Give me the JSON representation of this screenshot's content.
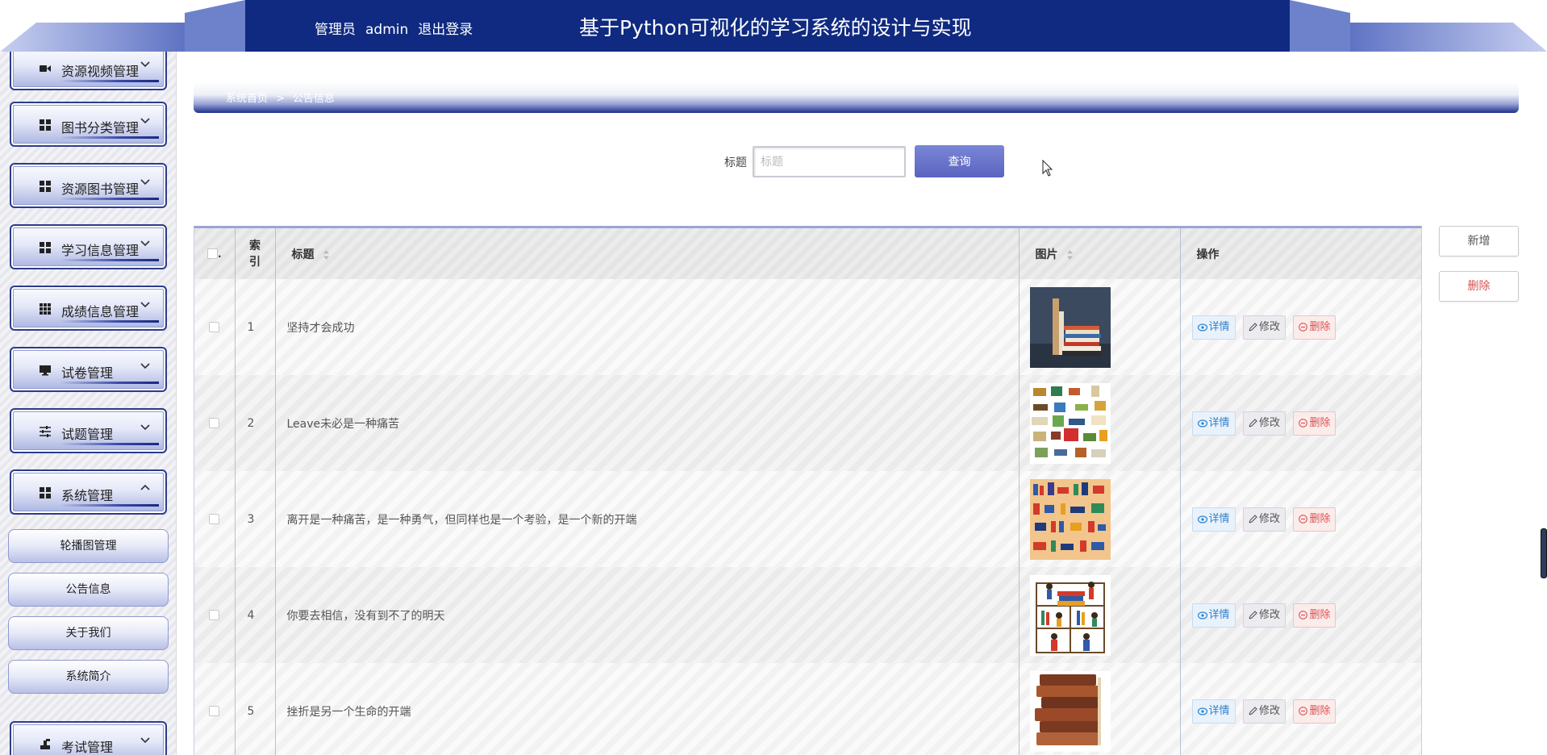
{
  "header": {
    "role": "管理员",
    "username": "admin",
    "logout_label": "退出登录",
    "title": "基于Python可视化的学习系统的设计与实现"
  },
  "sidebar": {
    "menus": [
      {
        "label": "资源视频管理",
        "icon": "video-camera-icon",
        "expanded": false
      },
      {
        "label": "图书分类管理",
        "icon": "grid-icon",
        "expanded": false
      },
      {
        "label": "资源图书管理",
        "icon": "grid-icon",
        "expanded": false
      },
      {
        "label": "学习信息管理",
        "icon": "grid-icon",
        "expanded": false
      },
      {
        "label": "成绩信息管理",
        "icon": "grid-nine-icon",
        "expanded": false
      },
      {
        "label": "试卷管理",
        "icon": "monitor-icon",
        "expanded": false
      },
      {
        "label": "试题管理",
        "icon": "sliders-icon",
        "expanded": false
      },
      {
        "label": "系统管理",
        "icon": "grid-icon",
        "expanded": true
      },
      {
        "label": "考试管理",
        "icon": "stamp-icon",
        "expanded": false
      }
    ],
    "submenu": [
      "轮播图管理",
      "公告信息",
      "关于我们",
      "系统简介"
    ]
  },
  "breadcrumb": {
    "home": "系统首页",
    "separator": ">",
    "current": "公告信息"
  },
  "search": {
    "label": "标题",
    "placeholder": "标题",
    "button": "查询"
  },
  "actions": {
    "add": "新增",
    "delete": "删除"
  },
  "table": {
    "columns": {
      "index": "索引",
      "title": "标题",
      "image": "图片",
      "operations": "操作"
    },
    "row_actions": {
      "detail": "详情",
      "edit": "修改",
      "delete": "删除"
    },
    "rows": [
      {
        "index": "1",
        "title": "坚持才会成功",
        "image": "book-stack-photo"
      },
      {
        "index": "2",
        "title": "Leave未必是一种痛苦",
        "image": "books-collage"
      },
      {
        "index": "3",
        "title": "离开是一种痛苦，是一种勇气，但同样也是一个考验，是一个新的开端",
        "image": "bookshelf-illustration"
      },
      {
        "index": "4",
        "title": "你要去相信，没有到不了的明天",
        "image": "library-people-illustration"
      },
      {
        "index": "5",
        "title": "挫折是另一个生命的开端",
        "image": "old-books-stack"
      }
    ]
  },
  "colors": {
    "header_dark": "#0f2a80",
    "accent_purple": "#5a64c0",
    "detail_blue": "#2d7fcf",
    "delete_red": "#d9534f"
  }
}
